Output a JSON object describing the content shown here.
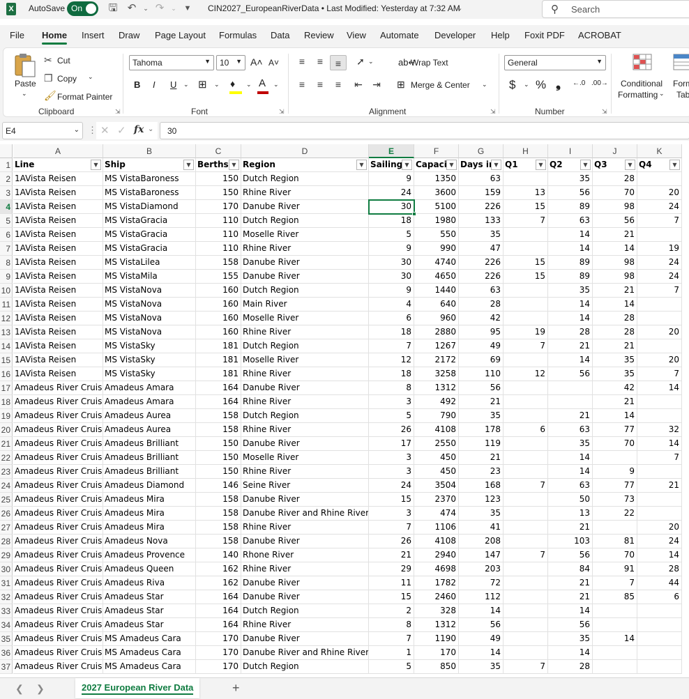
{
  "titlebar": {
    "app_icon": "X",
    "autosave_label": "AutoSave",
    "autosave_state": "On",
    "file_title": "CIN2027_EuropeanRiverData  •  Last Modified: Yesterday at 7:32 AM",
    "search_placeholder": "Search"
  },
  "menu": {
    "tabs": [
      "File",
      "Home",
      "Insert",
      "Draw",
      "Page Layout",
      "Formulas",
      "Data",
      "Review",
      "View",
      "Automate",
      "Developer",
      "Help",
      "Foxit PDF",
      "ACROBAT"
    ],
    "active": "Home"
  },
  "ribbon": {
    "clipboard": {
      "paste": "Paste",
      "cut": "Cut",
      "copy": "Copy",
      "format_painter": "Format Painter",
      "label": "Clipboard"
    },
    "font": {
      "name": "Tahoma",
      "size": "10",
      "label": "Font",
      "bold": "B",
      "italic": "I",
      "underline": "U"
    },
    "alignment": {
      "wrap": "Wrap Text",
      "merge": "Merge & Center",
      "label": "Alignment"
    },
    "number": {
      "format": "General",
      "currency": "$",
      "percent": "%",
      "comma": "❟",
      "label": "Number"
    },
    "styles": {
      "conditional": "Conditional",
      "formatting": "Formatting",
      "format_as": "Form",
      "table": "Tab"
    },
    "accent_color": "#107c41",
    "font_color_bar": "#c00000",
    "fill_color_bar": "#ffff00"
  },
  "formula_bar": {
    "name_box": "E4",
    "fx": "fx",
    "value": "30"
  },
  "sheet": {
    "columns": [
      "A",
      "B",
      "C",
      "D",
      "E",
      "F",
      "G",
      "H",
      "I",
      "J",
      "K"
    ],
    "selected_col": "E",
    "selected_row": "4",
    "headers": [
      "Line",
      "Ship",
      "Berths",
      "Region",
      "Sailings",
      "Capacity",
      "Days in",
      "Q1",
      "Q2",
      "Q3",
      "Q4"
    ],
    "rows": [
      [
        "1",
        "",
        "",
        "",
        "",
        "",
        "",
        "",
        "",
        "",
        "",
        ""
      ],
      [
        "2",
        "1AVista Reisen",
        "MS VistaBaroness",
        "150",
        "Dutch Region",
        "9",
        "1350",
        "63",
        "",
        "35",
        "28",
        ""
      ],
      [
        "3",
        "1AVista Reisen",
        "MS VistaBaroness",
        "150",
        "Rhine River",
        "24",
        "3600",
        "159",
        "13",
        "56",
        "70",
        "20"
      ],
      [
        "4",
        "1AVista Reisen",
        "MS VistaDiamond",
        "170",
        "Danube River",
        "30",
        "5100",
        "226",
        "15",
        "89",
        "98",
        "24"
      ],
      [
        "5",
        "1AVista Reisen",
        "MS VistaGracia",
        "110",
        "Dutch Region",
        "18",
        "1980",
        "133",
        "7",
        "63",
        "56",
        "7"
      ],
      [
        "6",
        "1AVista Reisen",
        "MS VistaGracia",
        "110",
        "Moselle River",
        "5",
        "550",
        "35",
        "",
        "14",
        "21",
        ""
      ],
      [
        "7",
        "1AVista Reisen",
        "MS VistaGracia",
        "110",
        "Rhine River",
        "9",
        "990",
        "47",
        "",
        "14",
        "14",
        "19"
      ],
      [
        "8",
        "1AVista Reisen",
        "MS VistaLilea",
        "158",
        "Danube River",
        "30",
        "4740",
        "226",
        "15",
        "89",
        "98",
        "24"
      ],
      [
        "9",
        "1AVista Reisen",
        "MS VistaMila",
        "155",
        "Danube River",
        "30",
        "4650",
        "226",
        "15",
        "89",
        "98",
        "24"
      ],
      [
        "10",
        "1AVista Reisen",
        "MS VistaNova",
        "160",
        "Dutch Region",
        "9",
        "1440",
        "63",
        "",
        "35",
        "21",
        "7"
      ],
      [
        "11",
        "1AVista Reisen",
        "MS VistaNova",
        "160",
        "Main River",
        "4",
        "640",
        "28",
        "",
        "14",
        "14",
        ""
      ],
      [
        "12",
        "1AVista Reisen",
        "MS VistaNova",
        "160",
        "Moselle River",
        "6",
        "960",
        "42",
        "",
        "14",
        "28",
        ""
      ],
      [
        "13",
        "1AVista Reisen",
        "MS VistaNova",
        "160",
        "Rhine River",
        "18",
        "2880",
        "95",
        "19",
        "28",
        "28",
        "20"
      ],
      [
        "14",
        "1AVista Reisen",
        "MS VistaSky",
        "181",
        "Dutch Region",
        "7",
        "1267",
        "49",
        "7",
        "21",
        "21",
        ""
      ],
      [
        "15",
        "1AVista Reisen",
        "MS VistaSky",
        "181",
        "Moselle River",
        "12",
        "2172",
        "69",
        "",
        "14",
        "35",
        "20"
      ],
      [
        "16",
        "1AVista Reisen",
        "MS VistaSky",
        "181",
        "Rhine River",
        "18",
        "3258",
        "110",
        "12",
        "56",
        "35",
        "7"
      ],
      [
        "17",
        "Amadeus River Cruise",
        "Amadeus Amara",
        "164",
        "Danube River",
        "8",
        "1312",
        "56",
        "",
        "",
        "42",
        "14"
      ],
      [
        "18",
        "Amadeus River Cruise",
        "Amadeus Amara",
        "164",
        "Rhine River",
        "3",
        "492",
        "21",
        "",
        "",
        "21",
        ""
      ],
      [
        "19",
        "Amadeus River Cruise",
        "Amadeus Aurea",
        "158",
        "Dutch Region",
        "5",
        "790",
        "35",
        "",
        "21",
        "14",
        ""
      ],
      [
        "20",
        "Amadeus River Cruise",
        "Amadeus Aurea",
        "158",
        "Rhine River",
        "26",
        "4108",
        "178",
        "6",
        "63",
        "77",
        "32"
      ],
      [
        "21",
        "Amadeus River Cruise",
        "Amadeus Brilliant",
        "150",
        "Danube River",
        "17",
        "2550",
        "119",
        "",
        "35",
        "70",
        "14"
      ],
      [
        "22",
        "Amadeus River Cruise",
        "Amadeus Brilliant",
        "150",
        "Moselle River",
        "3",
        "450",
        "21",
        "",
        "14",
        "",
        "7"
      ],
      [
        "23",
        "Amadeus River Cruise",
        "Amadeus Brilliant",
        "150",
        "Rhine River",
        "3",
        "450",
        "23",
        "",
        "14",
        "9",
        ""
      ],
      [
        "24",
        "Amadeus River Cruise",
        "Amadeus Diamond",
        "146",
        "Seine River",
        "24",
        "3504",
        "168",
        "7",
        "63",
        "77",
        "21"
      ],
      [
        "25",
        "Amadeus River Cruise",
        "Amadeus Mira",
        "158",
        "Danube River",
        "15",
        "2370",
        "123",
        "",
        "50",
        "73",
        ""
      ],
      [
        "26",
        "Amadeus River Cruise",
        "Amadeus Mira",
        "158",
        "Danube River and Rhine River",
        "3",
        "474",
        "35",
        "",
        "13",
        "22",
        ""
      ],
      [
        "27",
        "Amadeus River Cruise",
        "Amadeus Mira",
        "158",
        "Rhine River",
        "7",
        "1106",
        "41",
        "",
        "21",
        "",
        "20"
      ],
      [
        "28",
        "Amadeus River Cruise",
        "Amadeus Nova",
        "158",
        "Danube River",
        "26",
        "4108",
        "208",
        "",
        "103",
        "81",
        "24"
      ],
      [
        "29",
        "Amadeus River Cruise",
        "Amadeus Provence",
        "140",
        "Rhone River",
        "21",
        "2940",
        "147",
        "7",
        "56",
        "70",
        "14"
      ],
      [
        "30",
        "Amadeus River Cruise",
        "Amadeus Queen",
        "162",
        "Rhine River",
        "29",
        "4698",
        "203",
        "",
        "84",
        "91",
        "28"
      ],
      [
        "31",
        "Amadeus River Cruise",
        "Amadeus Riva",
        "162",
        "Danube River",
        "11",
        "1782",
        "72",
        "",
        "21",
        "7",
        "44"
      ],
      [
        "32",
        "Amadeus River Cruise",
        "Amadeus Star",
        "164",
        "Danube River",
        "15",
        "2460",
        "112",
        "",
        "21",
        "85",
        "6"
      ],
      [
        "33",
        "Amadeus River Cruise",
        "Amadeus Star",
        "164",
        "Dutch Region",
        "2",
        "328",
        "14",
        "",
        "14",
        "",
        ""
      ],
      [
        "34",
        "Amadeus River Cruise",
        "Amadeus Star",
        "164",
        "Rhine River",
        "8",
        "1312",
        "56",
        "",
        "56",
        "",
        ""
      ],
      [
        "35",
        "Amadeus River Cruise",
        "MS Amadeus Cara",
        "170",
        "Danube River",
        "7",
        "1190",
        "49",
        "",
        "35",
        "14",
        ""
      ],
      [
        "36",
        "Amadeus River Cruise",
        "MS Amadeus Cara",
        "170",
        "Danube River and Rhine River",
        "1",
        "170",
        "14",
        "",
        "14",
        "",
        ""
      ],
      [
        "37",
        "Amadeus River Cruise",
        "MS Amadeus Cara",
        "170",
        "Dutch Region",
        "5",
        "850",
        "35",
        "7",
        "28",
        "",
        ""
      ]
    ]
  },
  "sheet_tabs": {
    "active": "2027 European River Data",
    "add": "+"
  }
}
